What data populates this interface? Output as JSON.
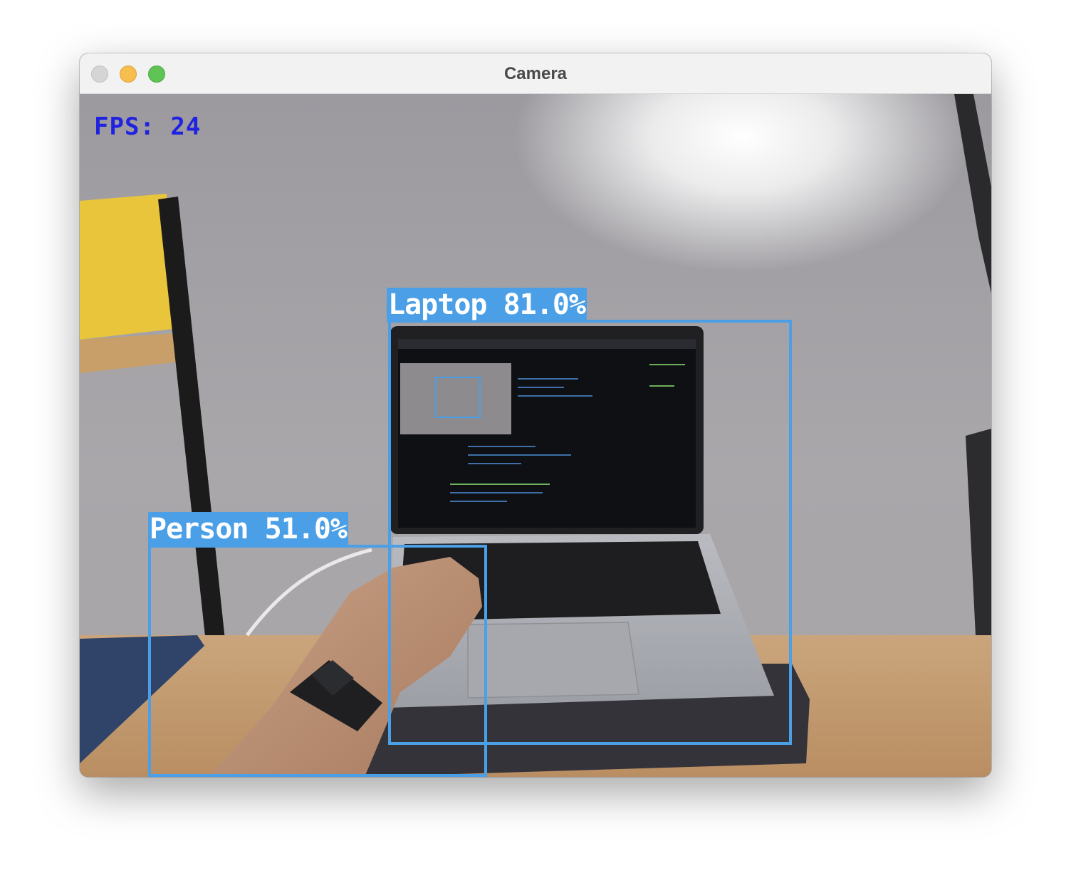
{
  "window": {
    "title": "Camera",
    "traffic_lights": [
      "close",
      "minimize",
      "maximize"
    ]
  },
  "overlay": {
    "fps_text": "FPS: 24",
    "fps_color": "#1f22e0",
    "box_color": "#4a9fe6",
    "detections": [
      {
        "label": "Laptop 81.0%",
        "class": "Laptop",
        "confidence": 81.0
      },
      {
        "label": "Person 51.0%",
        "class": "Person",
        "confidence": 51.0
      }
    ]
  }
}
